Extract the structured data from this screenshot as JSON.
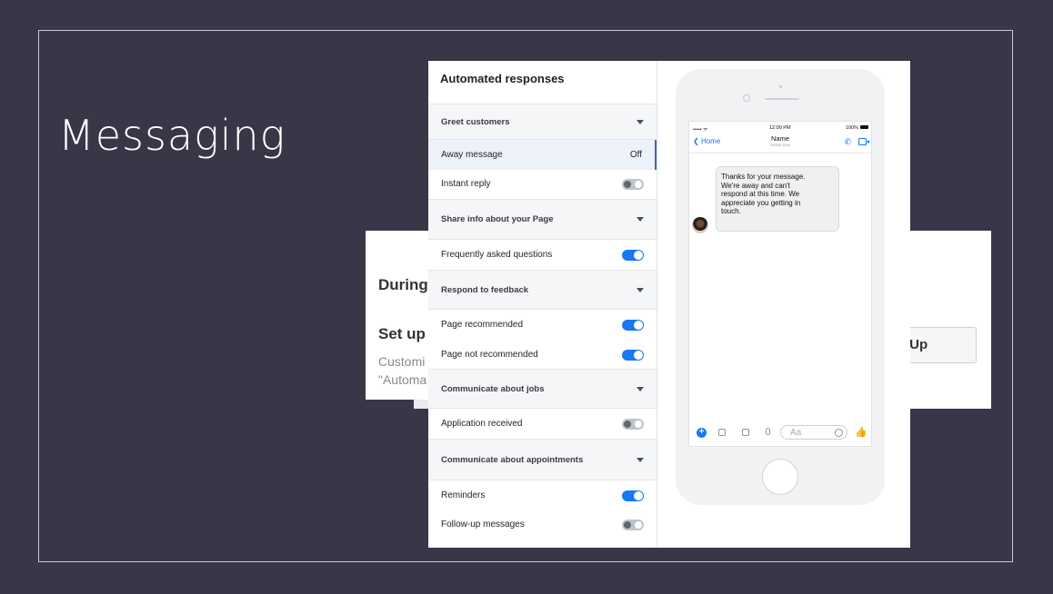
{
  "slide": {
    "title": "Messaging"
  },
  "back_card": {
    "during": "During",
    "setup": "Set up",
    "customize": "Customi",
    "automated": "\"Automa",
    "setup_button": "t Up"
  },
  "panel": {
    "title": "Automated responses",
    "rows": [
      {
        "kind": "section",
        "label": "Greet customers"
      },
      {
        "kind": "item",
        "label": "Away message",
        "status": "Off",
        "selected": true
      },
      {
        "kind": "item",
        "label": "Instant reply",
        "toggle": "off"
      },
      {
        "kind": "section",
        "label": "Share info about your Page"
      },
      {
        "kind": "item",
        "label": "Frequently asked questions",
        "toggle": "on"
      },
      {
        "kind": "section",
        "label": "Respond to feedback"
      },
      {
        "kind": "item",
        "label": "Page recommended",
        "toggle": "on"
      },
      {
        "kind": "item",
        "label": "Page not recommended",
        "toggle": "on"
      },
      {
        "kind": "section",
        "label": "Communicate about jobs"
      },
      {
        "kind": "item",
        "label": "Application received",
        "toggle": "off"
      },
      {
        "kind": "section",
        "label": "Communicate about appointments"
      },
      {
        "kind": "item",
        "label": "Reminders",
        "toggle": "on"
      },
      {
        "kind": "item",
        "label": "Follow-up messages",
        "toggle": "off"
      }
    ]
  },
  "phone": {
    "signal": "••••• ᯤ",
    "time": "12:00 PM",
    "battery": "100%",
    "back_label": "Home",
    "contact_name": "Name",
    "active_status": "Active now",
    "message_lines": [
      "Thanks for your message.",
      "We're away and can't",
      "respond at this time. We",
      "appreciate you getting in",
      "touch."
    ],
    "composer_placeholder": "Aa"
  }
}
